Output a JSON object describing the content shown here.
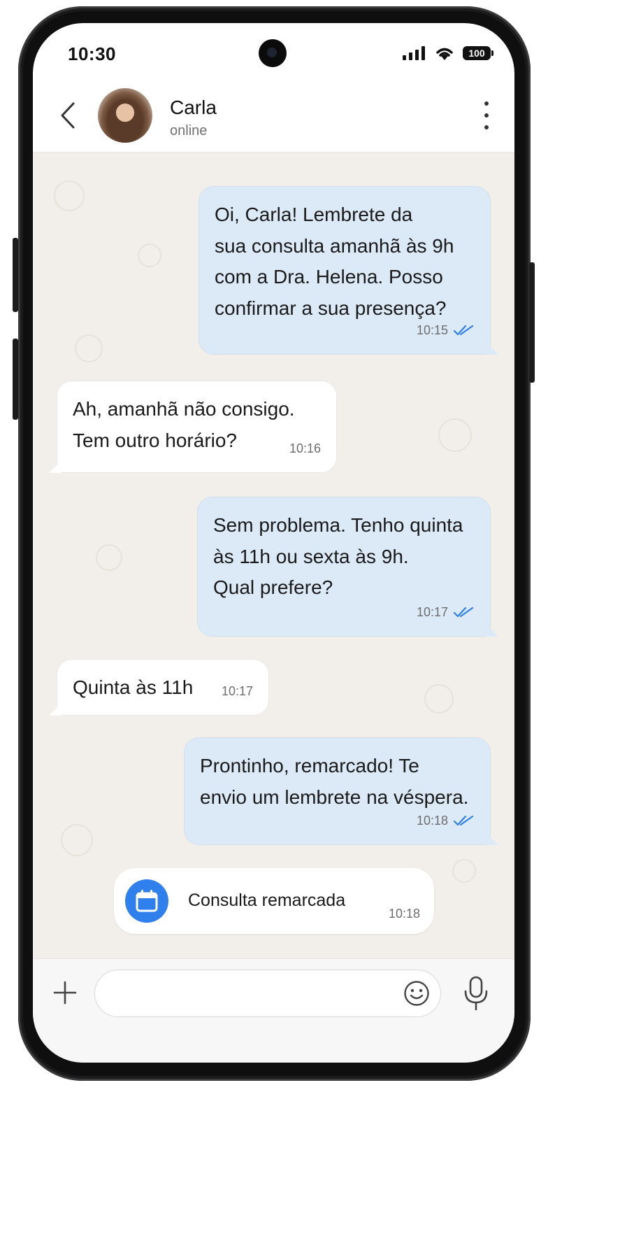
{
  "status_bar": {
    "time": "10:30",
    "battery": "100"
  },
  "header": {
    "contact_name": "Carla",
    "contact_status": "online",
    "back_icon": "chevron-left-icon",
    "menu_icon": "more-vertical-icon"
  },
  "messages": [
    {
      "direction": "outgoing",
      "lines": [
        "Oi, Carla! Lembrete da",
        "sua consulta amanhã às 9h",
        "com a Dra. Helena. Posso",
        "confirmar a sua presença?"
      ],
      "time": "10:15",
      "read": true
    },
    {
      "direction": "incoming",
      "lines": [
        "Ah, amanhã não consigo.",
        "Tem outro horário?"
      ],
      "time": "10:16"
    },
    {
      "direction": "outgoing",
      "lines": [
        "Sem problema. Tenho quinta",
        "às 11h ou sexta às 9h.",
        "Qual prefere?"
      ],
      "time": "10:17",
      "read": true
    },
    {
      "direction": "incoming",
      "lines": [
        "Quinta às 11h"
      ],
      "time": "10:17"
    },
    {
      "direction": "outgoing",
      "lines": [
        "Prontinho, remarcado! Te",
        "envio um lembrete na véspera."
      ],
      "time": "10:18",
      "read": true
    }
  ],
  "event": {
    "icon": "calendar-icon",
    "label": "Consulta remarcada",
    "time": "10:18"
  },
  "composer": {
    "placeholder": "",
    "attach_icon": "plus-icon",
    "emoji_icon": "smiley-icon",
    "mic_icon": "microphone-icon"
  },
  "colors": {
    "outgoing_bubble": "#dceaf8",
    "incoming_bubble": "#ffffff",
    "chat_background": "#f2efea",
    "read_ticks": "#2f80ed",
    "event_icon_bg": "#2f80ed"
  }
}
